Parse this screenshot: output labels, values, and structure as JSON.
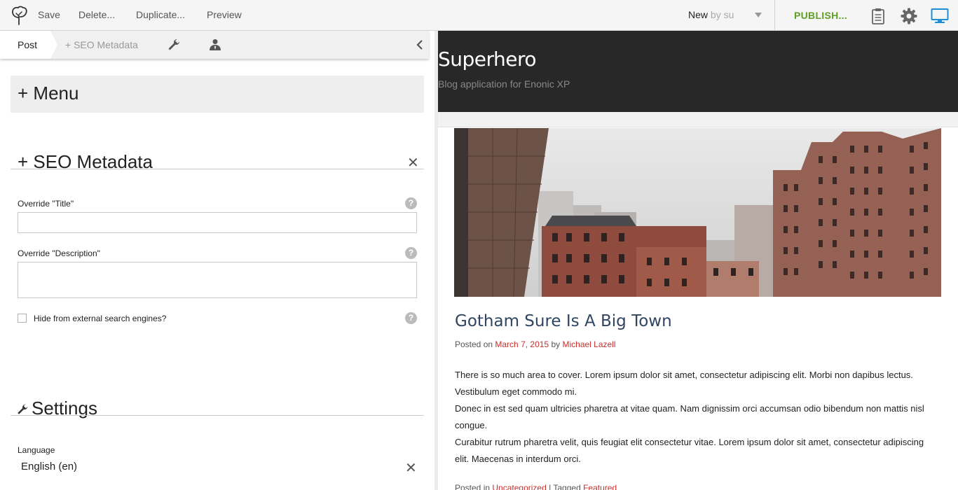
{
  "toolbar": {
    "save_label": "Save",
    "delete_label": "Delete...",
    "duplicate_label": "Duplicate...",
    "preview_label": "Preview",
    "status": "New",
    "status_by": "by su",
    "publish_label": "PUBLISH...",
    "publish_color": "#609e24"
  },
  "tabs": {
    "post": "Post",
    "seo": "+ SEO Metadata"
  },
  "form": {
    "menu_title": "Menu",
    "seo_title": "SEO Metadata",
    "override_title_label": "Override \"Title\"",
    "override_title_value": "",
    "override_description_label": "Override \"Description\"",
    "override_description_value": "",
    "hide_label": "Hide from external search engines?",
    "settings_title": "Settings",
    "language_label": "Language",
    "language_value": "English (en)"
  },
  "preview": {
    "site_title": "Superhero",
    "site_tagline": "Blog application for Enonic XP",
    "post_title": "Gotham Sure Is A Big Town",
    "posted_on": "Posted on",
    "date": "March 7, 2015",
    "by": "by",
    "author": "Michael Lazell",
    "paragraphs": [
      "There is so much area to cover. Lorem ipsum dolor sit amet, consectetur adipiscing elit. Morbi non dapibus lectus. Vestibulum eget commodo mi.",
      "Donec in est sed quam ultricies pharetra at vitae quam. Nam dignissim orci accumsan odio bibendum non mattis nisl congue.",
      "Curabitur rutrum pharetra velit, quis feugiat elit consectetur vitae. Lorem ipsum dolor sit amet, consectetur adipiscing elit. Maecenas in interdum orci."
    ],
    "posted_in": "Posted in",
    "category": "Uncategorized",
    "separator": "|",
    "tagged": "Tagged",
    "tag": "Featured",
    "link_color": "#c9302c"
  },
  "icons": {
    "logo": "enonic-tree-icon",
    "clipboard": "clipboard-icon",
    "settings": "gear-icon",
    "device": "monitor-icon"
  }
}
